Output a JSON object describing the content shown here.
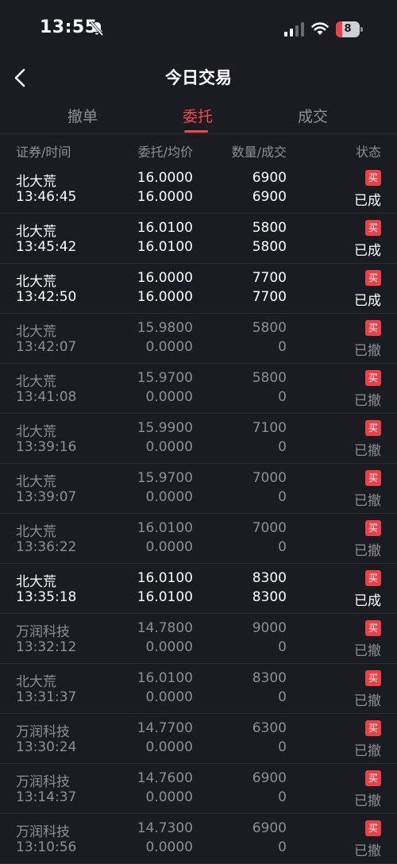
{
  "status_bar": {
    "time": "13:55",
    "battery": "8"
  },
  "nav": {
    "title": "今日交易"
  },
  "tabs": [
    {
      "label": "撤单"
    },
    {
      "label": "委托"
    },
    {
      "label": "成交"
    }
  ],
  "active_tab": "委托",
  "columns": {
    "security_time": "证券/时间",
    "price_avg": "委托/均价",
    "qty_filled": "数量/成交",
    "status": "状态"
  },
  "colors": {
    "accent": "#ef4a52",
    "background": "#1b1b22",
    "muted_text": "#8e8e96"
  },
  "orders": [
    {
      "name": "北大荒",
      "time": "13:46:45",
      "price": "16.0000",
      "avg": "16.0000",
      "qty": "6900",
      "filled": "6900",
      "side": "买",
      "status": "已成",
      "state": "done"
    },
    {
      "name": "北大荒",
      "time": "13:45:42",
      "price": "16.0100",
      "avg": "16.0100",
      "qty": "5800",
      "filled": "5800",
      "side": "买",
      "status": "已成",
      "state": "done"
    },
    {
      "name": "北大荒",
      "time": "13:42:50",
      "price": "16.0000",
      "avg": "16.0000",
      "qty": "7700",
      "filled": "7700",
      "side": "买",
      "status": "已成",
      "state": "done"
    },
    {
      "name": "北大荒",
      "time": "13:42:07",
      "price": "15.9800",
      "avg": "0.0000",
      "qty": "5800",
      "filled": "0",
      "side": "买",
      "status": "已撤",
      "state": "cancel"
    },
    {
      "name": "北大荒",
      "time": "13:41:08",
      "price": "15.9700",
      "avg": "0.0000",
      "qty": "5800",
      "filled": "0",
      "side": "买",
      "status": "已撤",
      "state": "cancel"
    },
    {
      "name": "北大荒",
      "time": "13:39:16",
      "price": "15.9900",
      "avg": "0.0000",
      "qty": "7100",
      "filled": "0",
      "side": "买",
      "status": "已撤",
      "state": "cancel"
    },
    {
      "name": "北大荒",
      "time": "13:39:07",
      "price": "15.9700",
      "avg": "0.0000",
      "qty": "7000",
      "filled": "0",
      "side": "买",
      "status": "已撤",
      "state": "cancel"
    },
    {
      "name": "北大荒",
      "time": "13:36:22",
      "price": "16.0100",
      "avg": "0.0000",
      "qty": "7000",
      "filled": "0",
      "side": "买",
      "status": "已撤",
      "state": "cancel"
    },
    {
      "name": "北大荒",
      "time": "13:35:18",
      "price": "16.0100",
      "avg": "16.0100",
      "qty": "8300",
      "filled": "8300",
      "side": "买",
      "status": "已成",
      "state": "done"
    },
    {
      "name": "万润科技",
      "time": "13:32:12",
      "price": "14.7800",
      "avg": "0.0000",
      "qty": "9000",
      "filled": "0",
      "side": "买",
      "status": "已撤",
      "state": "cancel"
    },
    {
      "name": "北大荒",
      "time": "13:31:37",
      "price": "16.0100",
      "avg": "0.0000",
      "qty": "8300",
      "filled": "0",
      "side": "买",
      "status": "已撤",
      "state": "cancel"
    },
    {
      "name": "万润科技",
      "time": "13:30:24",
      "price": "14.7700",
      "avg": "0.0000",
      "qty": "6300",
      "filled": "0",
      "side": "买",
      "status": "已撤",
      "state": "cancel"
    },
    {
      "name": "万润科技",
      "time": "13:14:37",
      "price": "14.7600",
      "avg": "0.0000",
      "qty": "6900",
      "filled": "0",
      "side": "买",
      "status": "已撤",
      "state": "cancel"
    },
    {
      "name": "万润科技",
      "time": "13:10:56",
      "price": "14.7300",
      "avg": "0.0000",
      "qty": "6900",
      "filled": "0",
      "side": "买",
      "status": "已撤",
      "state": "cancel"
    }
  ]
}
